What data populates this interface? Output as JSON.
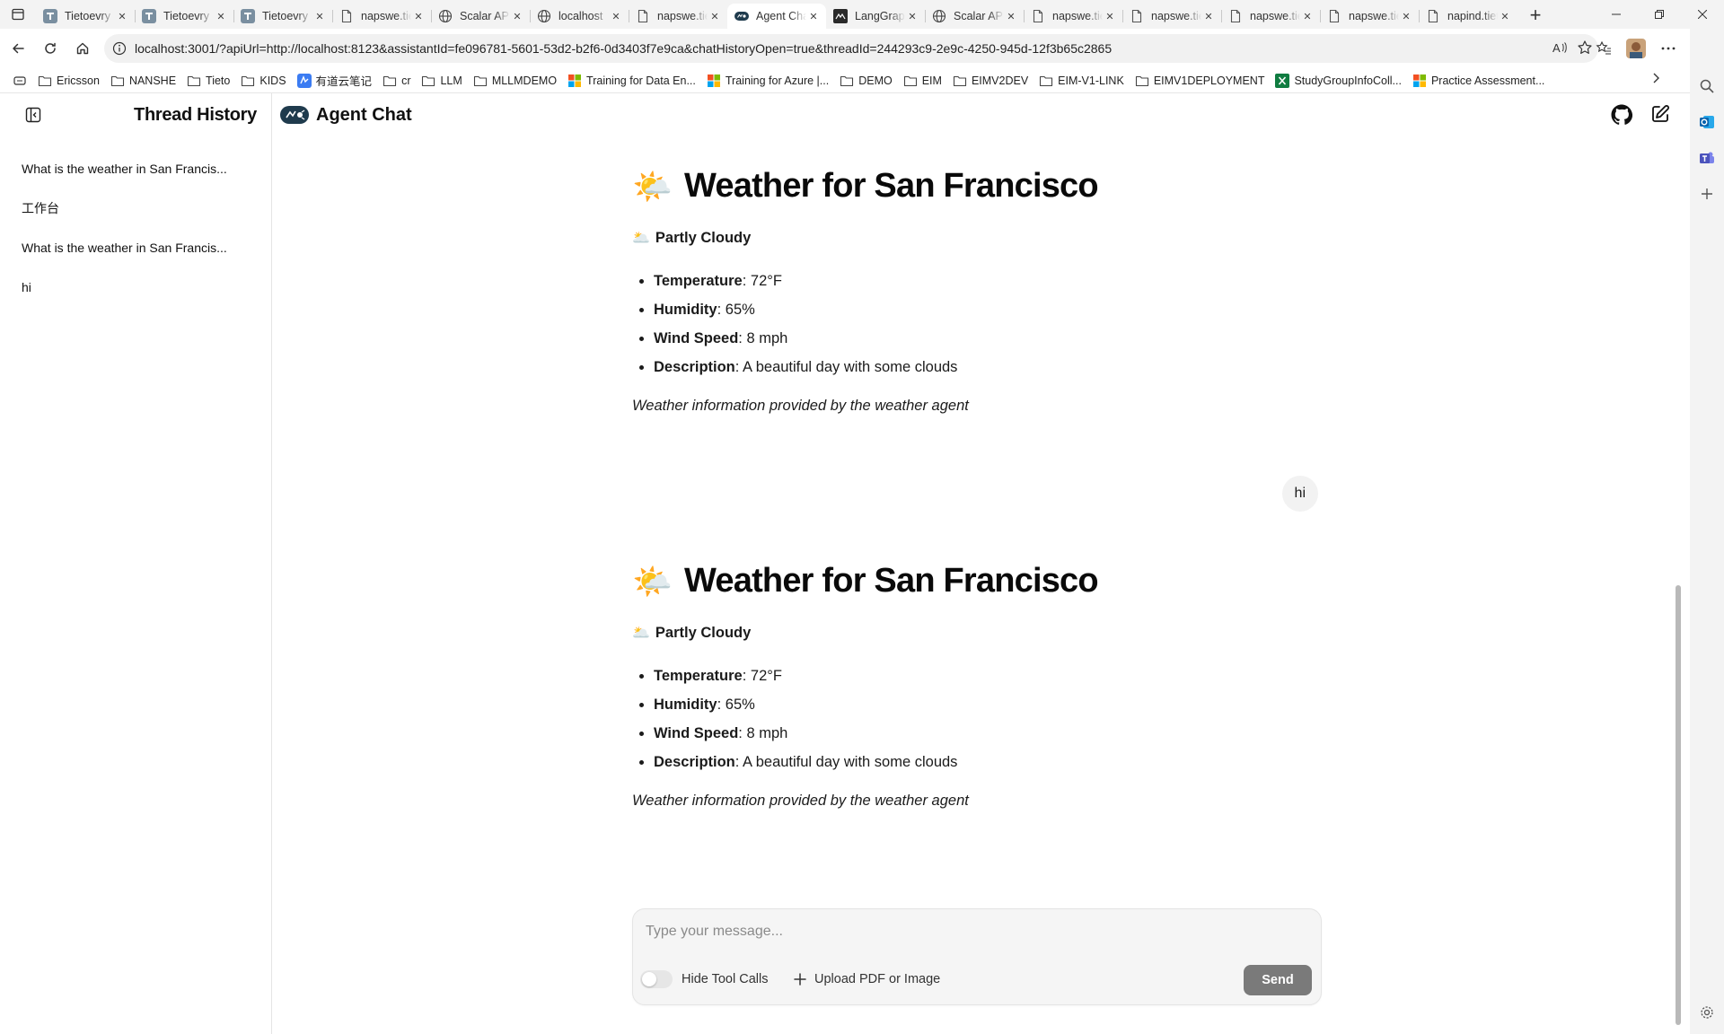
{
  "browser": {
    "tabs": [
      {
        "title": "Tietoevry",
        "icon": "tietoevry-icon"
      },
      {
        "title": "Tietoevry",
        "icon": "tietoevry-icon"
      },
      {
        "title": "Tietoevry",
        "icon": "tietoevry-icon"
      },
      {
        "title": "napswe.tieto",
        "icon": "doc-icon"
      },
      {
        "title": "Scalar API",
        "icon": "globe-icon"
      },
      {
        "title": "localhost",
        "icon": "globe-icon"
      },
      {
        "title": "napswe.tieto",
        "icon": "doc-icon"
      },
      {
        "title": "Agent Chat",
        "icon": "agent-icon",
        "active": true
      },
      {
        "title": "LangGraph",
        "icon": "langgraph-icon"
      },
      {
        "title": "Scalar API",
        "icon": "globe-icon"
      },
      {
        "title": "napswe.tieto",
        "icon": "doc-icon"
      },
      {
        "title": "napswe.tieto",
        "icon": "doc-icon"
      },
      {
        "title": "napswe.tieto",
        "icon": "doc-icon"
      },
      {
        "title": "napswe.tieto",
        "icon": "doc-icon"
      },
      {
        "title": "napind.tieto",
        "icon": "doc-icon"
      }
    ],
    "url": "localhost:3001/?apiUrl=http://localhost:8123&assistantId=fe096781-5601-53d2-b2f6-0d3403f7e9ca&chatHistoryOpen=true&threadId=244293c9-2e9c-4250-945d-12f3b65c2865",
    "bookmarks": [
      {
        "label": "Ericsson",
        "icon": "folder-icon"
      },
      {
        "label": "NANSHE",
        "icon": "folder-icon"
      },
      {
        "label": "Tieto",
        "icon": "folder-icon"
      },
      {
        "label": "KIDS",
        "icon": "folder-icon"
      },
      {
        "label": "有道云笔记",
        "icon": "youdao-icon"
      },
      {
        "label": "cr",
        "icon": "folder-icon"
      },
      {
        "label": "LLM",
        "icon": "folder-icon"
      },
      {
        "label": "MLLMDEMO",
        "icon": "folder-icon"
      },
      {
        "label": "Training for Data En...",
        "icon": "microsoft-icon"
      },
      {
        "label": "Training for Azure |...",
        "icon": "microsoft-icon"
      },
      {
        "label": "DEMO",
        "icon": "folder-icon"
      },
      {
        "label": "EIM",
        "icon": "folder-icon"
      },
      {
        "label": "EIMV2DEV",
        "icon": "folder-icon"
      },
      {
        "label": "EIM-V1-LINK",
        "icon": "folder-icon"
      },
      {
        "label": "EIMV1DEPLOYMENT",
        "icon": "folder-icon"
      },
      {
        "label": "StudyGroupInfoColl...",
        "icon": "excel-icon"
      },
      {
        "label": "Practice Assessment...",
        "icon": "microsoft-icon"
      }
    ]
  },
  "sidebar": {
    "title": "Thread History",
    "threads": [
      {
        "label": "What is the weather in San Francis..."
      },
      {
        "label": "工作台"
      },
      {
        "label": "What is the weather in San Francis..."
      },
      {
        "label": "hi"
      }
    ]
  },
  "header": {
    "app_name": "Agent Chat"
  },
  "messages": [
    {
      "role": "ai",
      "emoji": "🌤️",
      "heading": "Weather for San Francisco",
      "condition_emoji": "🌥️",
      "condition": "Partly Cloudy",
      "items": [
        {
          "label": "Temperature",
          "value": ": 72°F"
        },
        {
          "label": "Humidity",
          "value": ": 65%"
        },
        {
          "label": "Wind Speed",
          "value": ": 8 mph"
        },
        {
          "label": "Description",
          "value": ": A beautiful day with some clouds"
        }
      ],
      "credit": "Weather information provided by the weather agent"
    },
    {
      "role": "human",
      "text": "hi"
    },
    {
      "role": "ai",
      "emoji": "🌤️",
      "heading": "Weather for San Francisco",
      "condition_emoji": "🌥️",
      "condition": "Partly Cloudy",
      "items": [
        {
          "label": "Temperature",
          "value": ": 72°F"
        },
        {
          "label": "Humidity",
          "value": ": 65%"
        },
        {
          "label": "Wind Speed",
          "value": ": 8 mph"
        },
        {
          "label": "Description",
          "value": ": A beautiful day with some clouds"
        }
      ],
      "credit": "Weather information provided by the weather agent"
    }
  ],
  "composer": {
    "placeholder": "Type your message...",
    "hide_tool_calls_label": "Hide Tool Calls",
    "hide_tool_calls_on": false,
    "upload_label": "Upload PDF or Image",
    "send_label": "Send"
  },
  "colors": {
    "send_button": "#7a7a7a",
    "bubble": "#f2f2f2"
  }
}
